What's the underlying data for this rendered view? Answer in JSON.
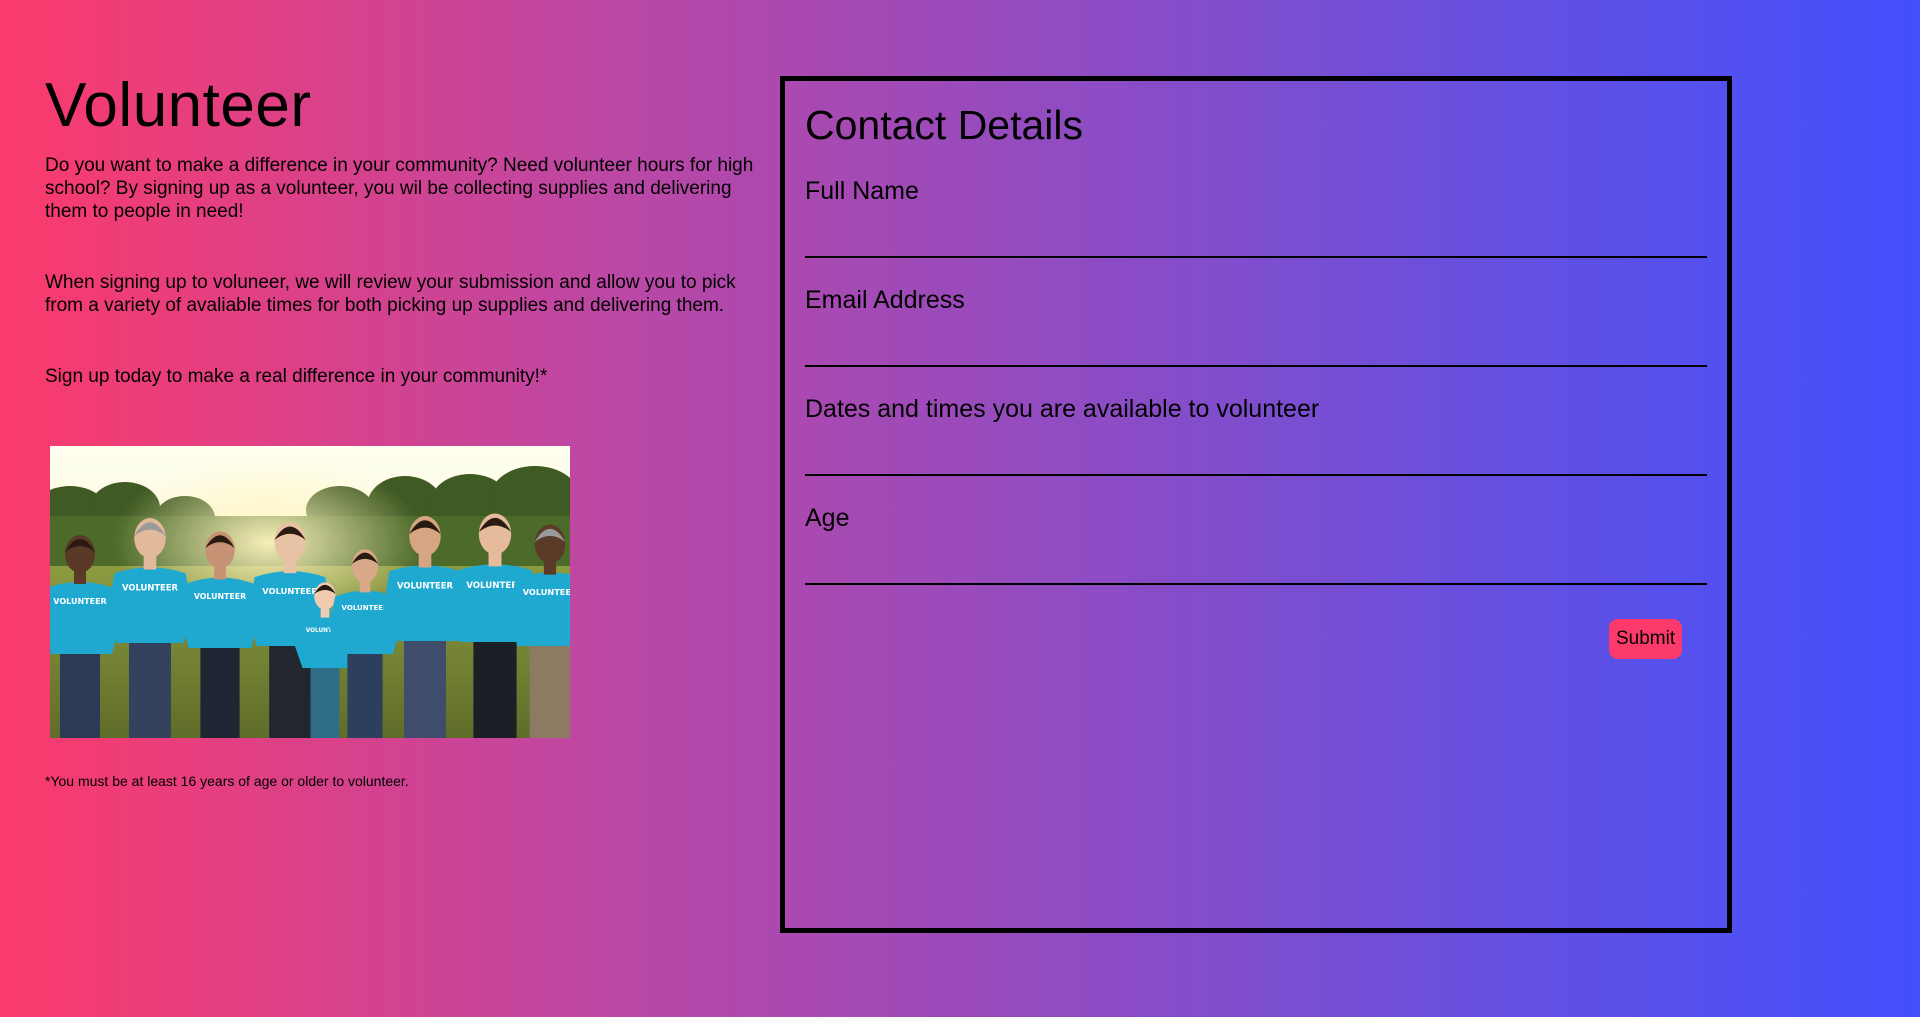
{
  "page": {
    "title": "Volunteer",
    "paragraphs": [
      "Do you want to make a difference in your community? Need volunteer hours for high school? By signing up as a volunteer, you wil be collecting supplies and delivering them to people in need!",
      "When signing up to voluneer, we will review your submission and allow you to pick from a variety of avaliable times for both picking up supplies and delivering them.",
      "Sign up today to make a real difference in your community!*"
    ],
    "photo_shirt_text": "VOLUNTEER",
    "disclaimer": "*You must be at least 16 years of age or older to volunteer."
  },
  "form": {
    "title": "Contact Details",
    "fields": [
      {
        "label": "Full Name",
        "value": ""
      },
      {
        "label": "Email Address",
        "value": ""
      },
      {
        "label": "Dates and times you are available to volunteer",
        "value": ""
      },
      {
        "label": "Age",
        "value": ""
      }
    ],
    "submit_label": "Submit"
  },
  "colors": {
    "gradient_start": "#fb3a6b",
    "gradient_end": "#434ffd",
    "submit_button": "#fb3a6b"
  }
}
